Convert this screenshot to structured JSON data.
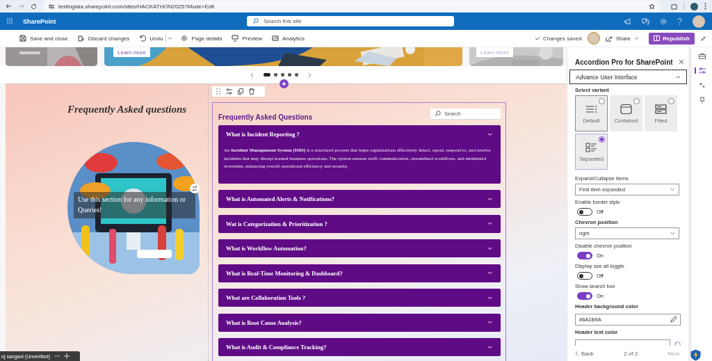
{
  "browser": {
    "url": "testinglala.sharepoint.com/sites/HACKATHON2025?Mode=Edit"
  },
  "suite_bar": {
    "app_name": "SharePoint",
    "search_placeholder": "Search this site"
  },
  "command_bar": {
    "items": [
      {
        "kind": "save",
        "label": "Save and close"
      },
      {
        "kind": "discard",
        "label": "Discard changes"
      },
      {
        "kind": "undo",
        "label": "Undo"
      },
      {
        "kind": "details",
        "label": "Page details"
      },
      {
        "kind": "preview",
        "label": "Preview"
      },
      {
        "kind": "analytics",
        "label": "Analytics"
      }
    ],
    "status": "Changes saved",
    "share": "Share",
    "publish": "Republish"
  },
  "carousel": {
    "cards": [
      {
        "kind": "picture"
      },
      {
        "kind": "picture",
        "link": "Learn more"
      },
      {
        "kind": "picture",
        "link": "Learn More"
      }
    ],
    "dots": [
      {
        "selected": true
      },
      {
        "selected": false
      },
      {
        "selected": false
      },
      {
        "selected": false
      },
      {
        "selected": false
      }
    ]
  },
  "intro": {
    "heading": "Frequently Asked questions",
    "caption": "Use this section for any information or Queries!"
  },
  "faq": {
    "title": "Frequently Asked Questions",
    "search_placeholder": "Search",
    "items": [
      {
        "question": "What is Incident Reporting ?",
        "expanded": true,
        "answer": "An **Incident Management System (IMS)** is a structured process that helps organizations effectively detect, report, respond to, and resolve incidents that may disrupt normal business operations. The system ensures swift communication, streamlined workflows, and minimized downtime, enhancing overall operational efficiency and security."
      },
      {
        "question": "What is Automated Alerts & Notifications?",
        "expanded": false
      },
      {
        "question": "Wat is Categorization & Prioritization ?",
        "expanded": false
      },
      {
        "question": "What is Workflow Automation?",
        "expanded": false
      },
      {
        "question": "What is Real-Time Monitoring & Dashboard?",
        "expanded": false
      },
      {
        "question": "What are Collaboration Tools ?",
        "expanded": false
      },
      {
        "question": "What is Root Cause Analysis?",
        "expanded": false
      },
      {
        "question": "What is Audit & Compliance Tracking?",
        "expanded": false
      }
    ]
  },
  "panel": {
    "title": "Accordion Pro for SharePoint",
    "section": "Advance User Interface",
    "variant_label": "Select variant",
    "variants": [
      {
        "kind": "default",
        "label": "Default",
        "selected": false
      },
      {
        "kind": "contained",
        "label": "Contained",
        "selected": false
      },
      {
        "kind": "filled",
        "label": "Filled",
        "selected": false
      },
      {
        "kind": "separated",
        "label": "Separated",
        "selected": true
      }
    ],
    "fields": [
      {
        "kind": "dropdown",
        "label": "Expand/Collapse items",
        "bold": false,
        "value": "First item expanded"
      },
      {
        "kind": "toggle",
        "label": "Enable border style",
        "bold": false,
        "on": false,
        "state_label": "Off"
      },
      {
        "kind": "dropdown",
        "label": "Chevron position",
        "bold": true,
        "value": "right"
      },
      {
        "kind": "toggle",
        "label": "Disable chevron position",
        "bold": false,
        "on": true,
        "state_label": "On"
      },
      {
        "kind": "toggle",
        "label": "Display see all toggle",
        "bold": false,
        "on": false,
        "state_label": "Off"
      },
      {
        "kind": "toggle",
        "label": "Show search box",
        "bold": false,
        "on": true,
        "state_label": "On"
      },
      {
        "kind": "color",
        "label": "Header background color",
        "bold": true,
        "value": "#6A1B9A"
      },
      {
        "kind": "color",
        "label": "Header text color",
        "bold": true
      }
    ],
    "pager": {
      "back": "Back",
      "page": "2 of 2",
      "next": {
        "label": "Next",
        "disabled": true
      }
    }
  },
  "presence": {
    "name": "nj sangani (Unverified)"
  }
}
